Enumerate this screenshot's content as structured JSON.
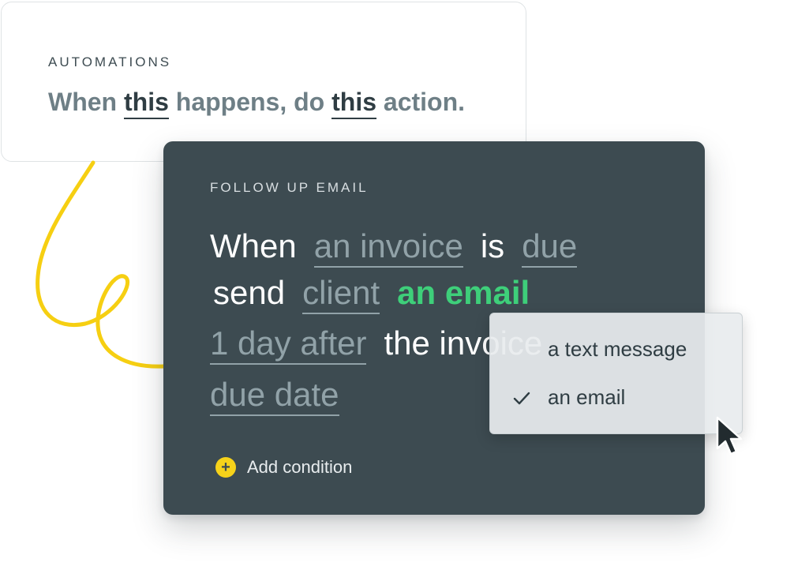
{
  "automations_card": {
    "eyebrow": "AUTOMATIONS",
    "sentence": {
      "part1": "When ",
      "token1": "this",
      "part2": " happens, do ",
      "token2": "this",
      "part3": " action."
    }
  },
  "follow_up_card": {
    "eyebrow": "FOLLOW UP EMAIL",
    "line1": {
      "word1": "When",
      "token1": "an invoice",
      "word2": "is",
      "token2": "due"
    },
    "line2": {
      "word1": "send",
      "token1": "client",
      "token_active": "an email"
    },
    "line3": {
      "token1": "1 day after",
      "word1": "the invoice"
    },
    "line4": {
      "token1": "due date"
    },
    "add_condition": "Add condition"
  },
  "dropdown": {
    "options": [
      {
        "label": "a text message",
        "selected": false
      },
      {
        "label": "an email",
        "selected": true
      }
    ]
  },
  "colors": {
    "card_dark": "#3d4b51",
    "accent_green": "#3ecf7a",
    "accent_yellow": "#f6d21a",
    "token_gray": "#91a2a8"
  },
  "icons": [
    "plus-circle-icon",
    "checkmark-icon",
    "mouse-pointer-icon",
    "yellow-squiggle-decoration"
  ]
}
